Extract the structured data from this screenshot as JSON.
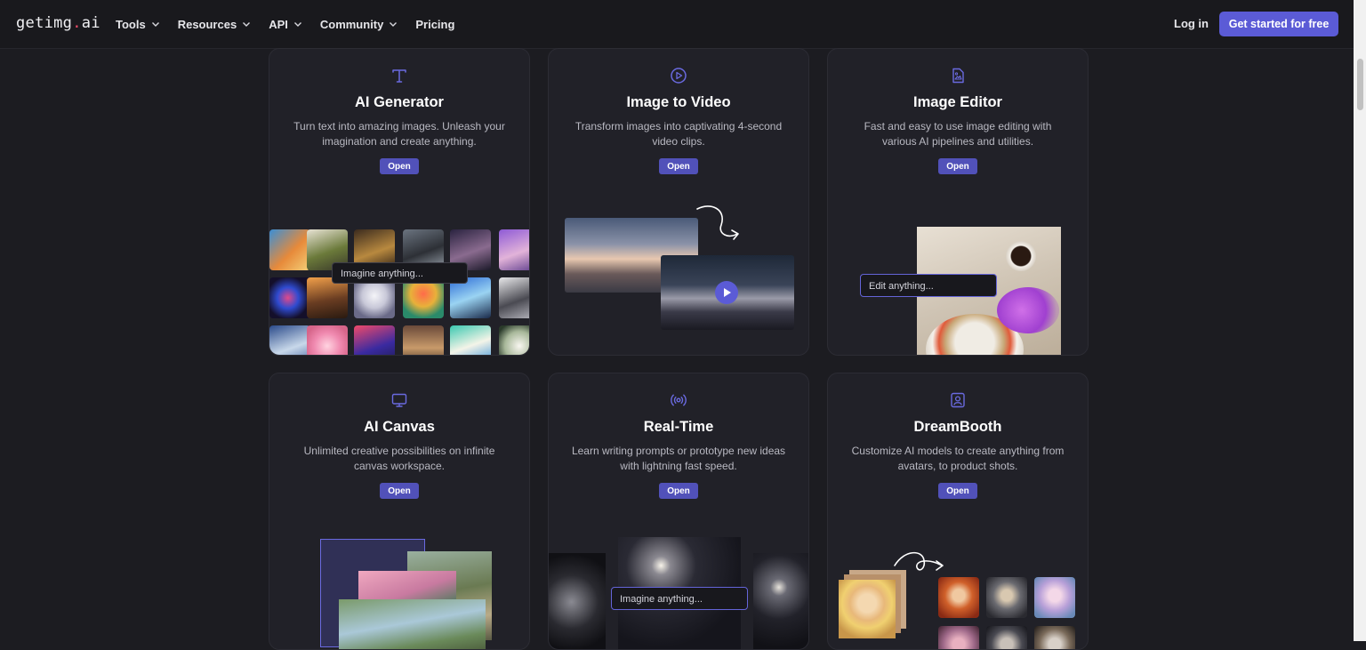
{
  "nav": {
    "logo_main": "getimg",
    "logo_dot": ".",
    "logo_tld": "ai",
    "menu": [
      {
        "label": "Tools",
        "dropdown": true
      },
      {
        "label": "Resources",
        "dropdown": true
      },
      {
        "label": "API",
        "dropdown": true
      },
      {
        "label": "Community",
        "dropdown": true
      },
      {
        "label": "Pricing",
        "dropdown": false
      }
    ],
    "login": "Log in",
    "cta": "Get started for free"
  },
  "colors": {
    "accent": "#5b5bd6",
    "background": "#1c1c21",
    "card": "#212128",
    "icon": "#6a6ae0"
  },
  "cards": [
    {
      "icon": "text-icon",
      "title": "AI Generator",
      "description": "Turn text into amazing images. Unleash your imagination and create anything.",
      "button": "Open",
      "prompt_placeholder": "Imagine anything..."
    },
    {
      "icon": "play-circle-icon",
      "title": "Image to Video",
      "description": "Transform images into captivating 4-second video clips.",
      "button": "Open"
    },
    {
      "icon": "image-edit-icon",
      "title": "Image Editor",
      "description": "Fast and easy to use image editing with various AI pipelines and utilities.",
      "button": "Open",
      "prompt_placeholder": "Edit anything..."
    },
    {
      "icon": "monitor-icon",
      "title": "AI Canvas",
      "description": "Unlimited creative possibilities on infinite canvas workspace.",
      "button": "Open"
    },
    {
      "icon": "broadcast-icon",
      "title": "Real-Time",
      "description": "Learn writing prompts or prototype new ideas with lightning fast speed.",
      "button": "Open",
      "prompt_placeholder": "Imagine anything..."
    },
    {
      "icon": "user-square-icon",
      "title": "DreamBooth",
      "description": "Customize AI models to create anything from avatars, to product shots.",
      "button": "Open"
    }
  ]
}
